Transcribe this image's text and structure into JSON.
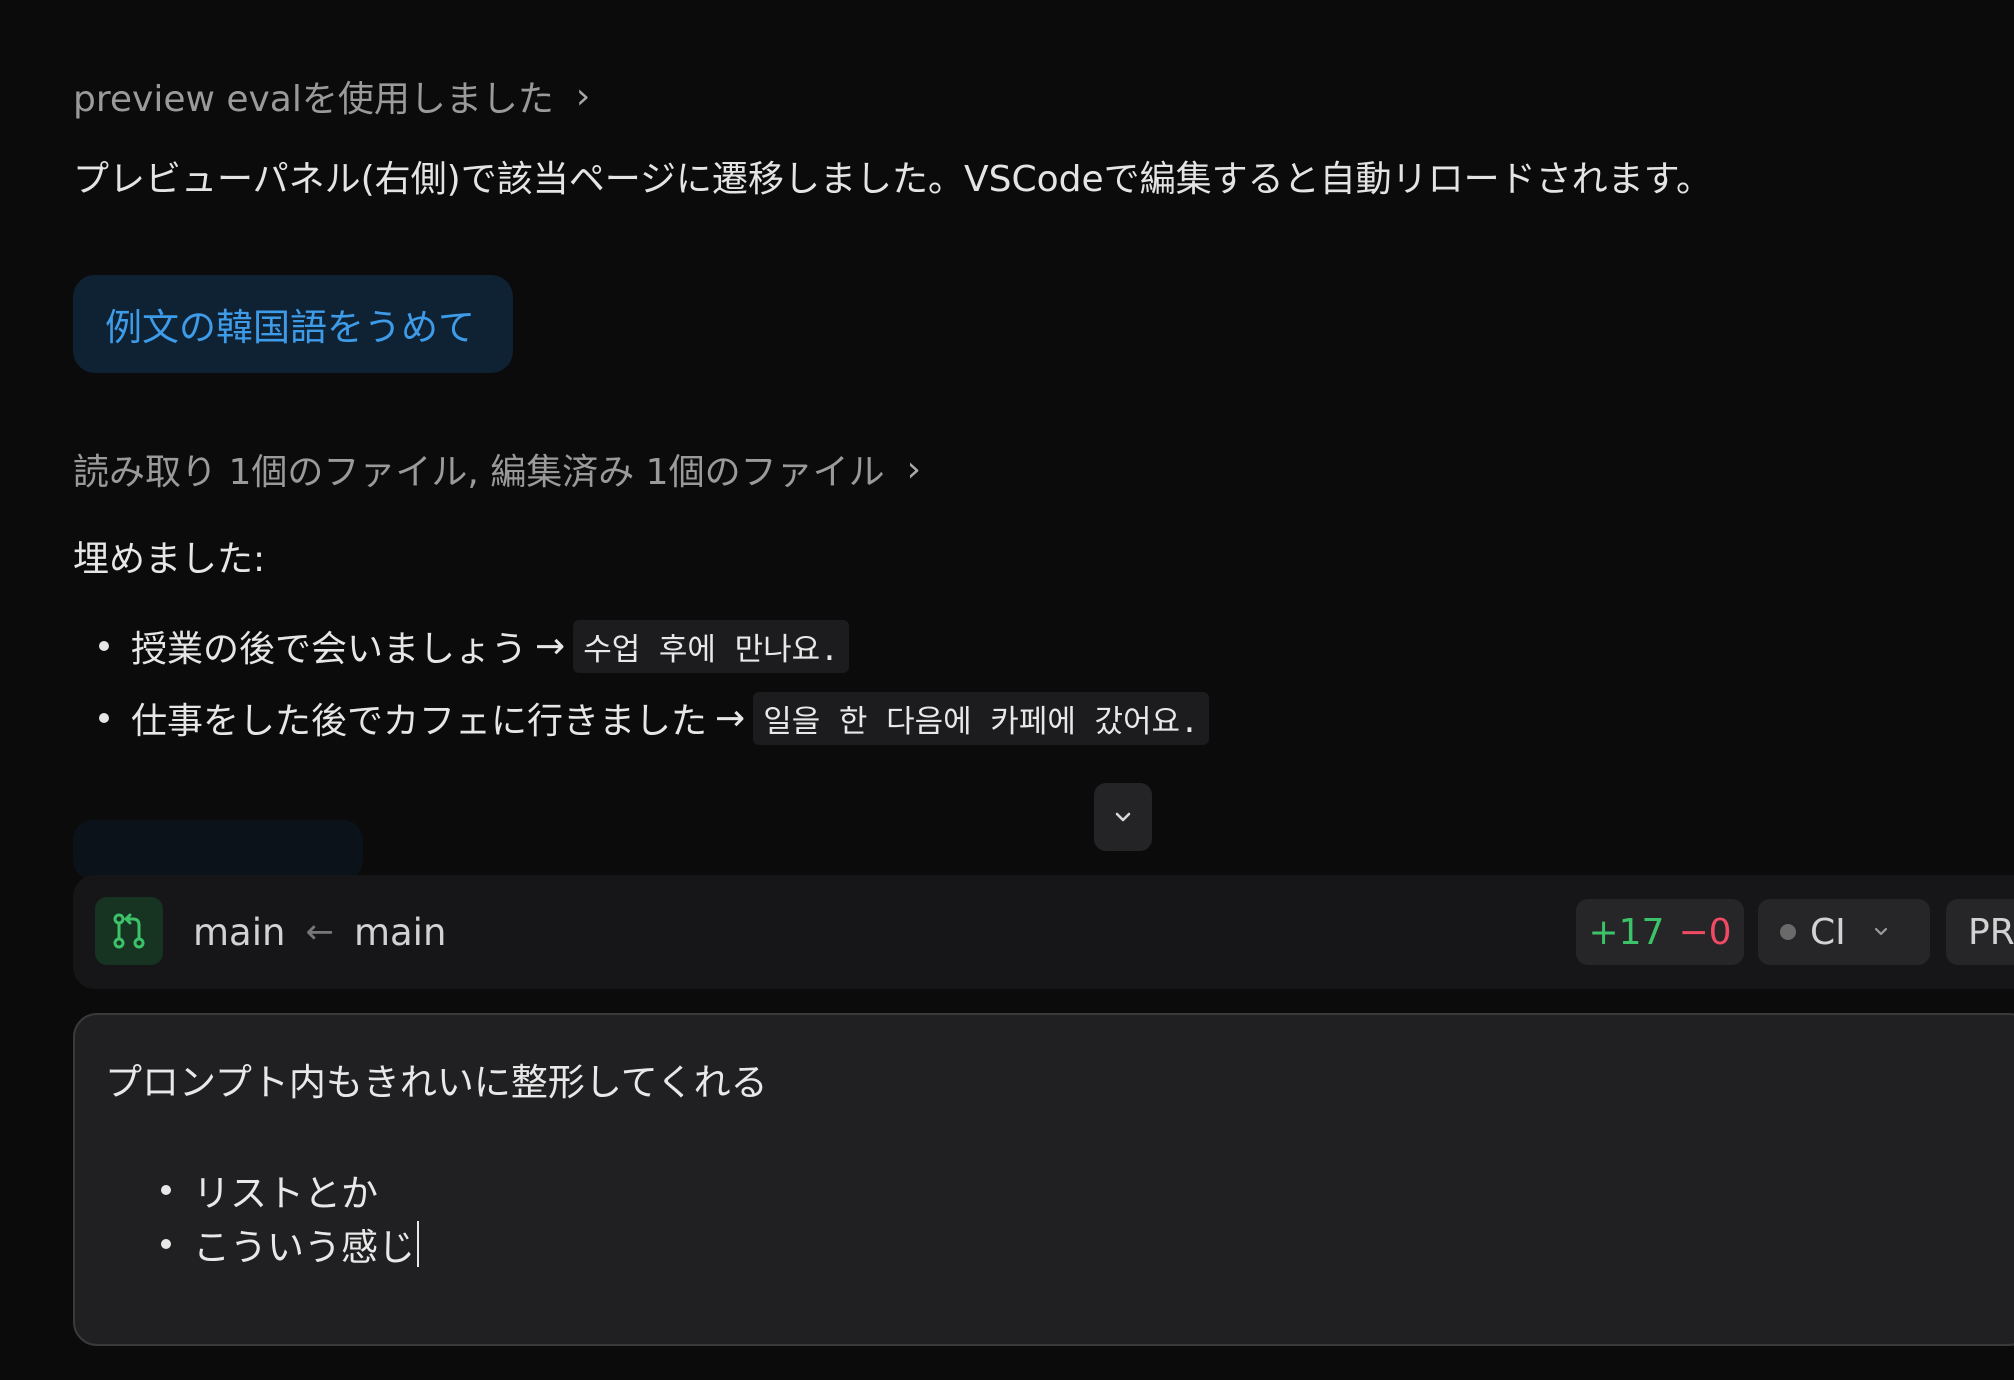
{
  "tool_calls": [
    {
      "label": "preview evalを使用しました"
    },
    {
      "label": "読み取り 1個のファイル, 編集済み 1個のファイル"
    }
  ],
  "assistant_message": "プレビューパネル(右側)で該当ページに遷移しました。VSCodeで編集すると自動リロードされます。",
  "user_prompt": "例文の韓国語をうめて",
  "result": {
    "heading": "埋めました:",
    "items": [
      {
        "ja": "授業の後で会いましょう",
        "arrow": "→",
        "ko": "수업 후에 만나요."
      },
      {
        "ja": "仕事をした後でカフェに行きました",
        "arrow": "→",
        "ko": "일을 한 다음에 카페에 갔어요."
      }
    ]
  },
  "branch_bar": {
    "target_branch": "main",
    "arrow": "←",
    "source_branch": "main",
    "additions": "+17",
    "deletions": "−0",
    "ci_label": "CI",
    "pr_label": "PR"
  },
  "composer": {
    "line1": "プロンプト内もきれいに整形してくれる",
    "bullets": [
      "リストとか",
      "こういう感じ"
    ]
  },
  "colors": {
    "background": "#0b0b0c",
    "accent_blue": "#3e9be8",
    "addition_green": "#3cc36a",
    "deletion_red": "#f04a64"
  }
}
